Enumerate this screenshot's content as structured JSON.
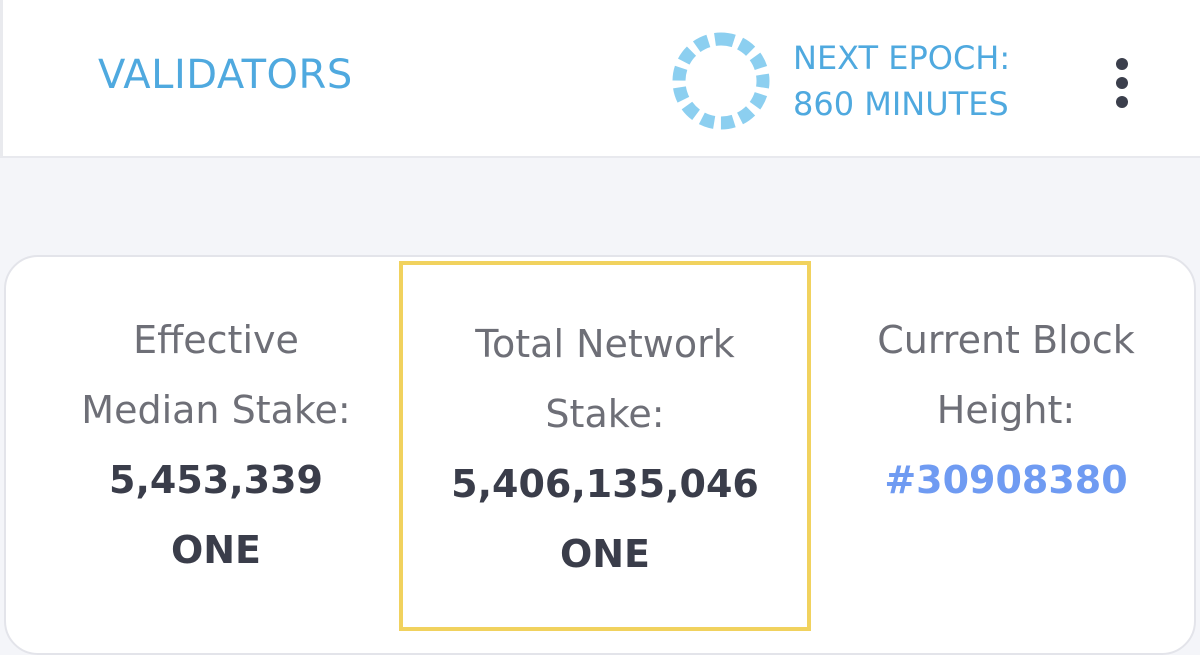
{
  "header": {
    "title": "VALIDATORS",
    "epoch_line1": "NEXT EPOCH:",
    "epoch_line2": "860 MINUTES",
    "accent_color": "#4fa9df",
    "menu_icon": "vertical-ellipsis-icon",
    "epoch_icon": "dashed-progress-ring-icon"
  },
  "stats": {
    "effective_median_stake": {
      "label_line1": "Effective",
      "label_line2": "Median Stake:",
      "value": "5,453,339",
      "unit": "ONE"
    },
    "total_network_stake": {
      "label_line1": "Total Network",
      "label_line2": "Stake:",
      "value": "5,406,135,046",
      "unit": "ONE",
      "highlight_color": "#f1d25e"
    },
    "current_block_height": {
      "label_line1": "Current Block",
      "label_line2": "Height:",
      "value": "#30908380",
      "link_color": "#6f9bf2"
    }
  }
}
